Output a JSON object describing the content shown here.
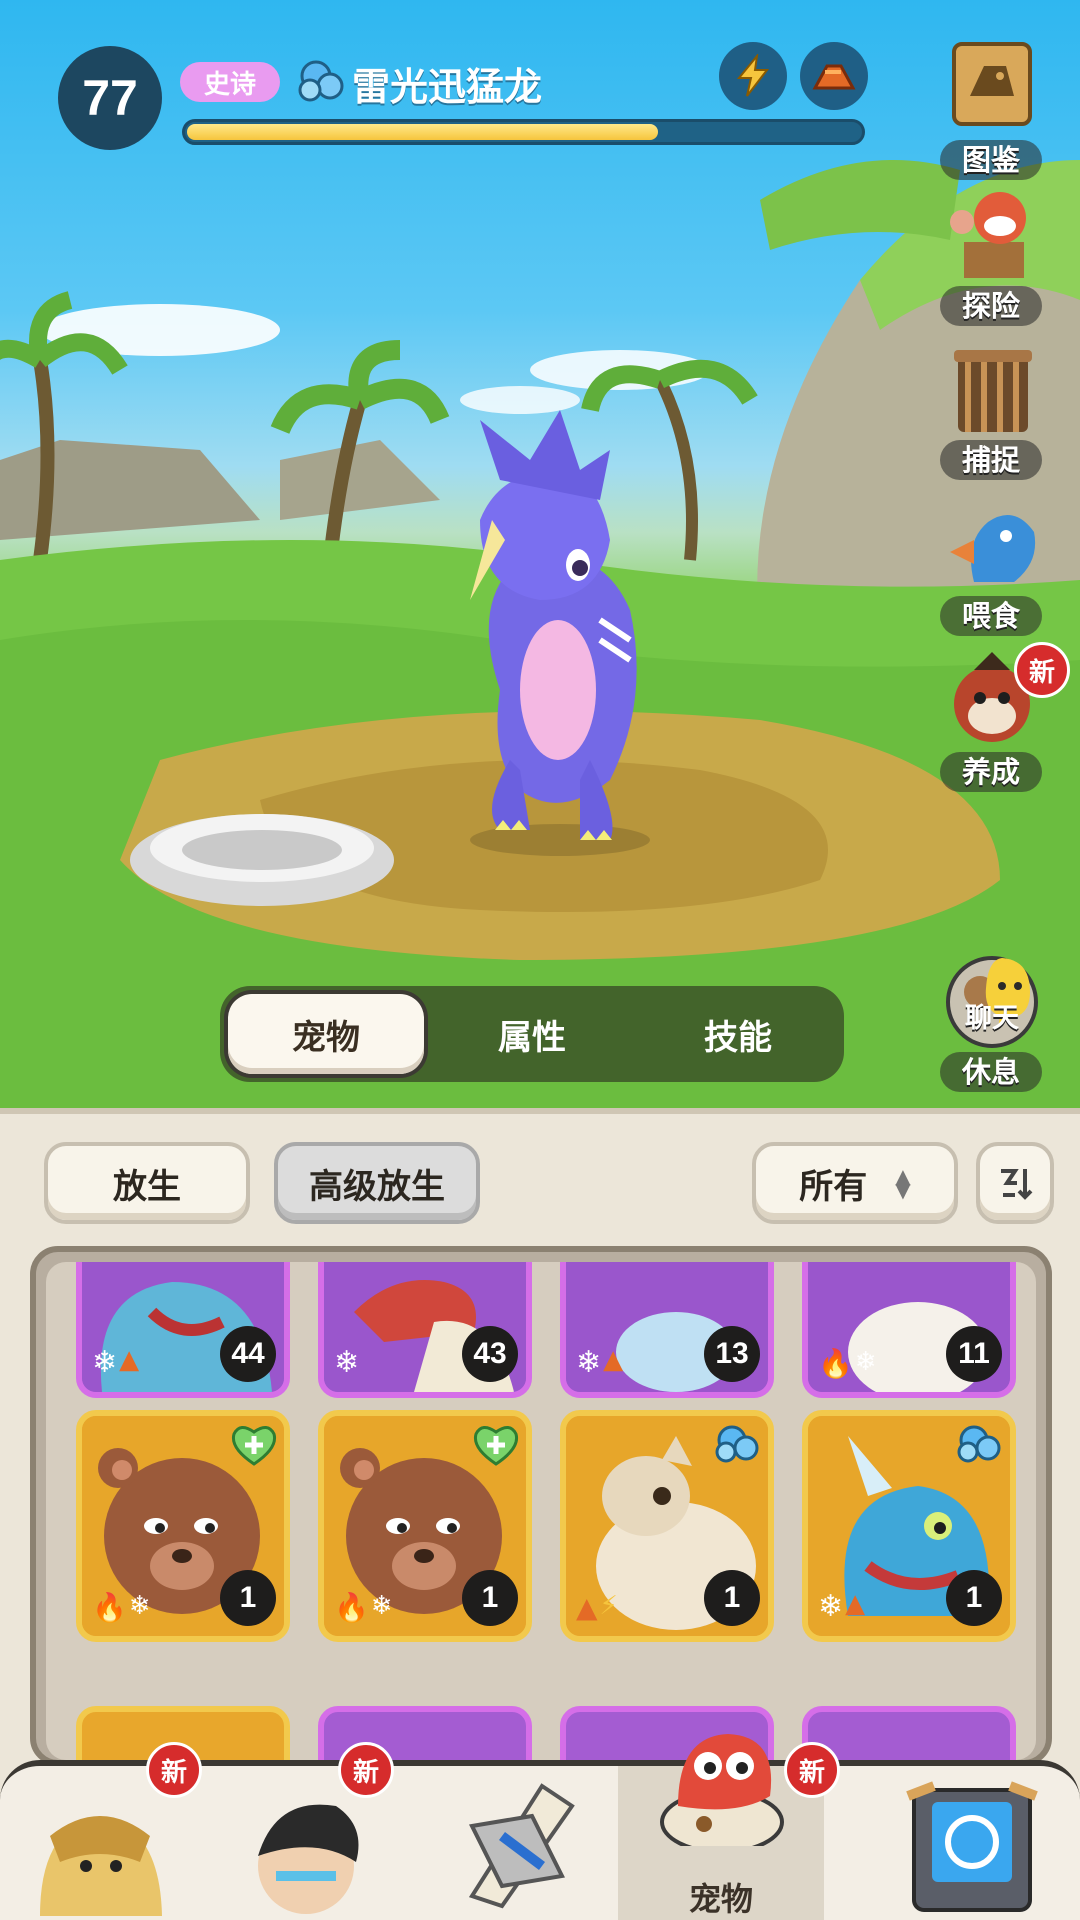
{
  "header": {
    "level": "77",
    "rarity": "史诗",
    "pet_name": "雷光迅猛龙",
    "exp_progress": 0.7
  },
  "side_menu": [
    {
      "label": "图鉴",
      "icon": "book-icon"
    },
    {
      "label": "探险",
      "icon": "explore-icon"
    },
    {
      "label": "捕捉",
      "icon": "cage-icon"
    },
    {
      "label": "喂食",
      "icon": "feed-icon"
    },
    {
      "label": "养成",
      "icon": "train-icon",
      "badge": "新"
    },
    {
      "label": "休息",
      "icon": "rest-icon",
      "sub_label": "聊天"
    }
  ],
  "tabs": [
    {
      "label": "宠物",
      "active": true
    },
    {
      "label": "属性",
      "active": false
    },
    {
      "label": "技能",
      "active": false
    }
  ],
  "actions": {
    "release": "放生",
    "advanced_release": "高级放生",
    "filter": "所有"
  },
  "pets": [
    {
      "count": "44",
      "frame": "purple",
      "elements": [
        "ice",
        "earth"
      ]
    },
    {
      "count": "43",
      "frame": "purple",
      "elements": [
        "ice"
      ]
    },
    {
      "count": "13",
      "frame": "purple",
      "elements": [
        "ice",
        "earth"
      ]
    },
    {
      "count": "11",
      "frame": "purple",
      "elements": [
        "fire",
        "ice"
      ]
    },
    {
      "count": "1",
      "frame": "gold",
      "elements": [
        "fire",
        "ice"
      ],
      "corner": "heal"
    },
    {
      "count": "1",
      "frame": "gold",
      "elements": [
        "fire",
        "ice"
      ],
      "corner": "heal"
    },
    {
      "count": "1",
      "frame": "gold",
      "elements": [
        "earth",
        "electric"
      ],
      "corner": "wind"
    },
    {
      "count": "1",
      "frame": "gold",
      "elements": [
        "ice",
        "earth"
      ],
      "corner": "wind"
    }
  ],
  "bottom_nav": [
    {
      "label": "",
      "icon": "caveman-icon",
      "badge": "新"
    },
    {
      "label": "",
      "icon": "hunter-icon",
      "badge": "新"
    },
    {
      "label": "",
      "icon": "weapon-icon",
      "badge": ""
    },
    {
      "label": "宠物",
      "icon": "pet-icon",
      "badge": "新",
      "active": true
    },
    {
      "label": "",
      "icon": "portal-icon",
      "badge": ""
    }
  ],
  "colors": {
    "sky": "#2fb7f0",
    "grass": "#7bc64a",
    "rarity_pill": "#e99bf0",
    "exp_fill": "#f6c53d",
    "badge_red": "#d62c2c",
    "card_gold": "#f2c94c",
    "card_purple": "#d56ee8"
  }
}
